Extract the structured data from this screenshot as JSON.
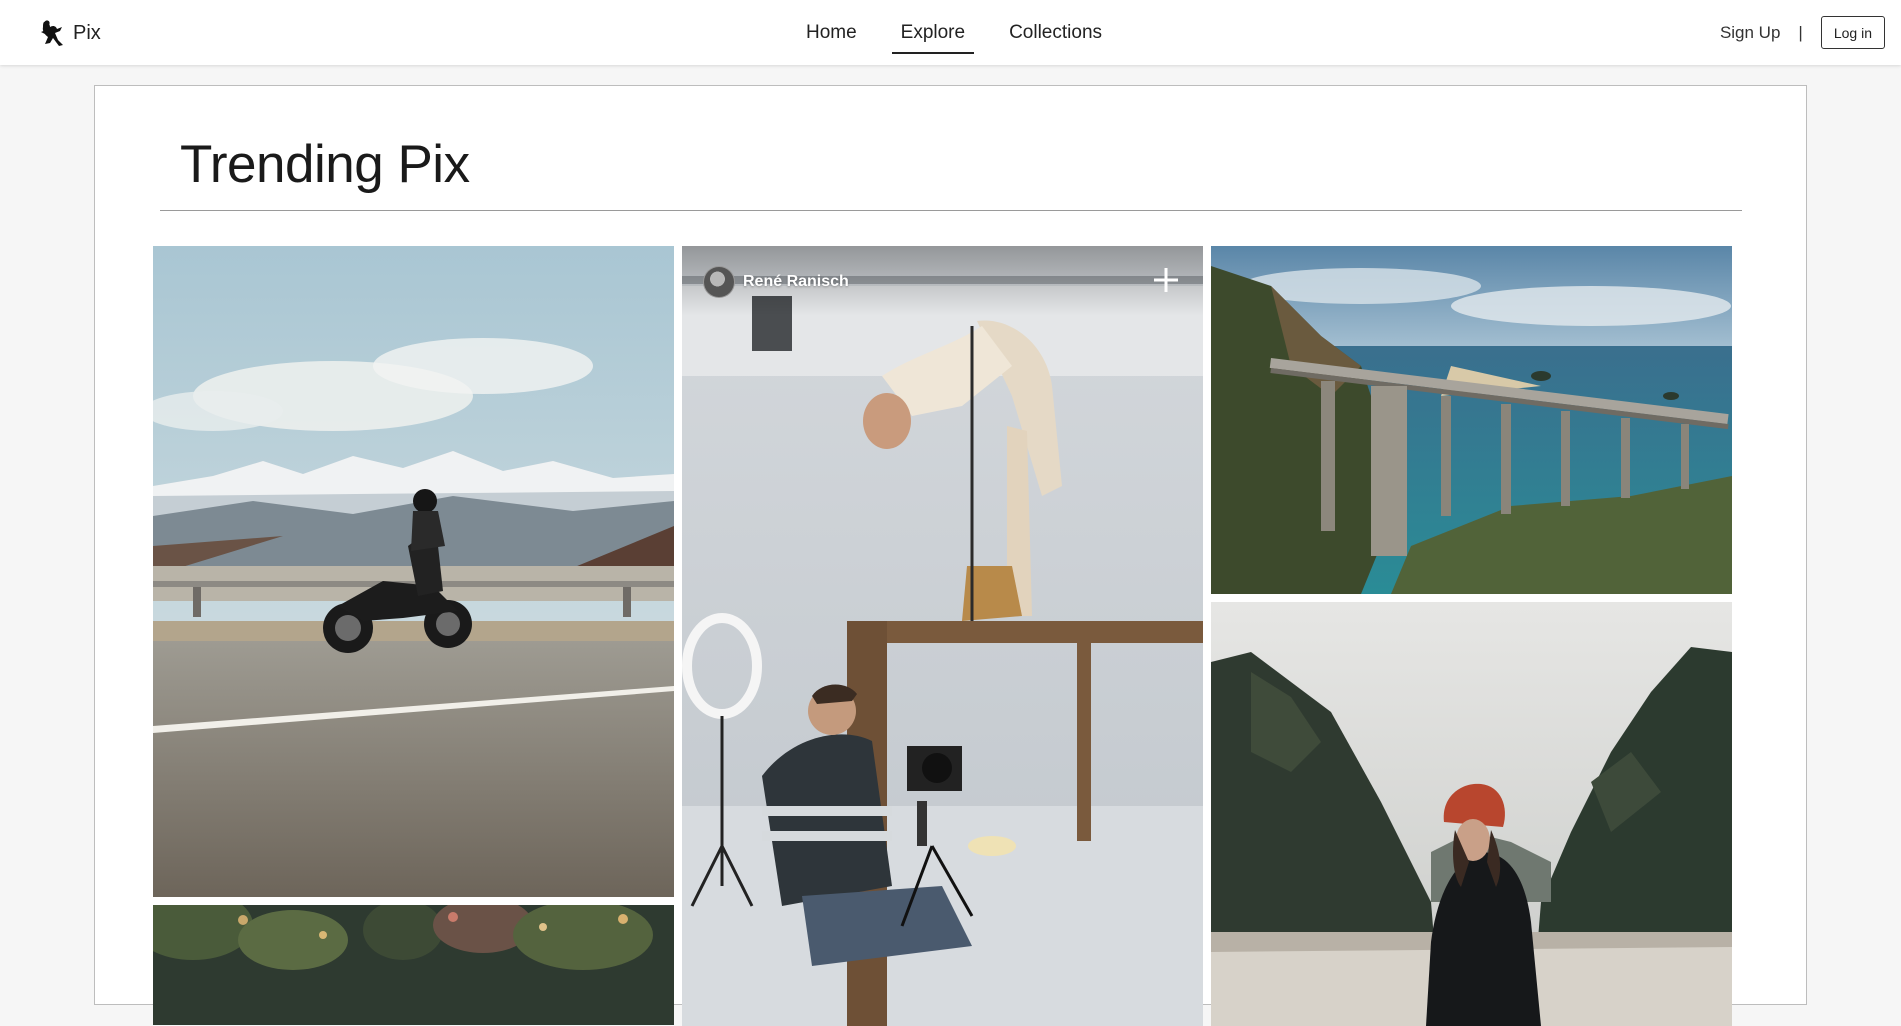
{
  "brand": {
    "name": "Pix",
    "logo_icon": "leaping-figure-logo"
  },
  "nav": {
    "items": [
      {
        "label": "Home",
        "active": false
      },
      {
        "label": "Explore",
        "active": true
      },
      {
        "label": "Collections",
        "active": false
      }
    ]
  },
  "auth": {
    "signup_label": "Sign Up",
    "separator": "|",
    "login_label": "Log in"
  },
  "page": {
    "title": "Trending Pix"
  },
  "photos": [
    {
      "subject": "motorcycle-mountain-road"
    },
    {
      "subject": "photo-studio-shoot",
      "author": "René Ranisch",
      "add_icon": "plus-icon",
      "hovered": true
    },
    {
      "subject": "coastal-bridge"
    },
    {
      "subject": "woman-in-valley"
    },
    {
      "subject": "garden-foliage"
    }
  ],
  "colors": {
    "accent": "#222222",
    "background": "#f6f6f6",
    "card": "#ffffff"
  }
}
